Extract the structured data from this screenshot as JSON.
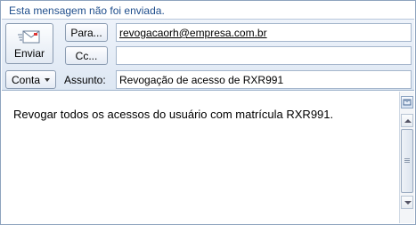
{
  "infobar": {
    "text": "Esta mensagem não foi enviada."
  },
  "send": {
    "label": "Enviar",
    "icon": "envelope-icon"
  },
  "fields": {
    "to_label": "Para...",
    "to_value": "revogacaorh@empresa.com.br",
    "cc_label": "Cc...",
    "cc_value": "",
    "account_label": "Conta",
    "subject_label": "Assunto:",
    "subject_value": "Revogação de acesso de RXR991"
  },
  "body": {
    "text": "Revogar todos os acessos do usuário com matrícula RXR991."
  },
  "colors": {
    "infobar_text": "#1f4e8c",
    "header_bg": "#dde7f3",
    "border": "#8ea3be"
  }
}
